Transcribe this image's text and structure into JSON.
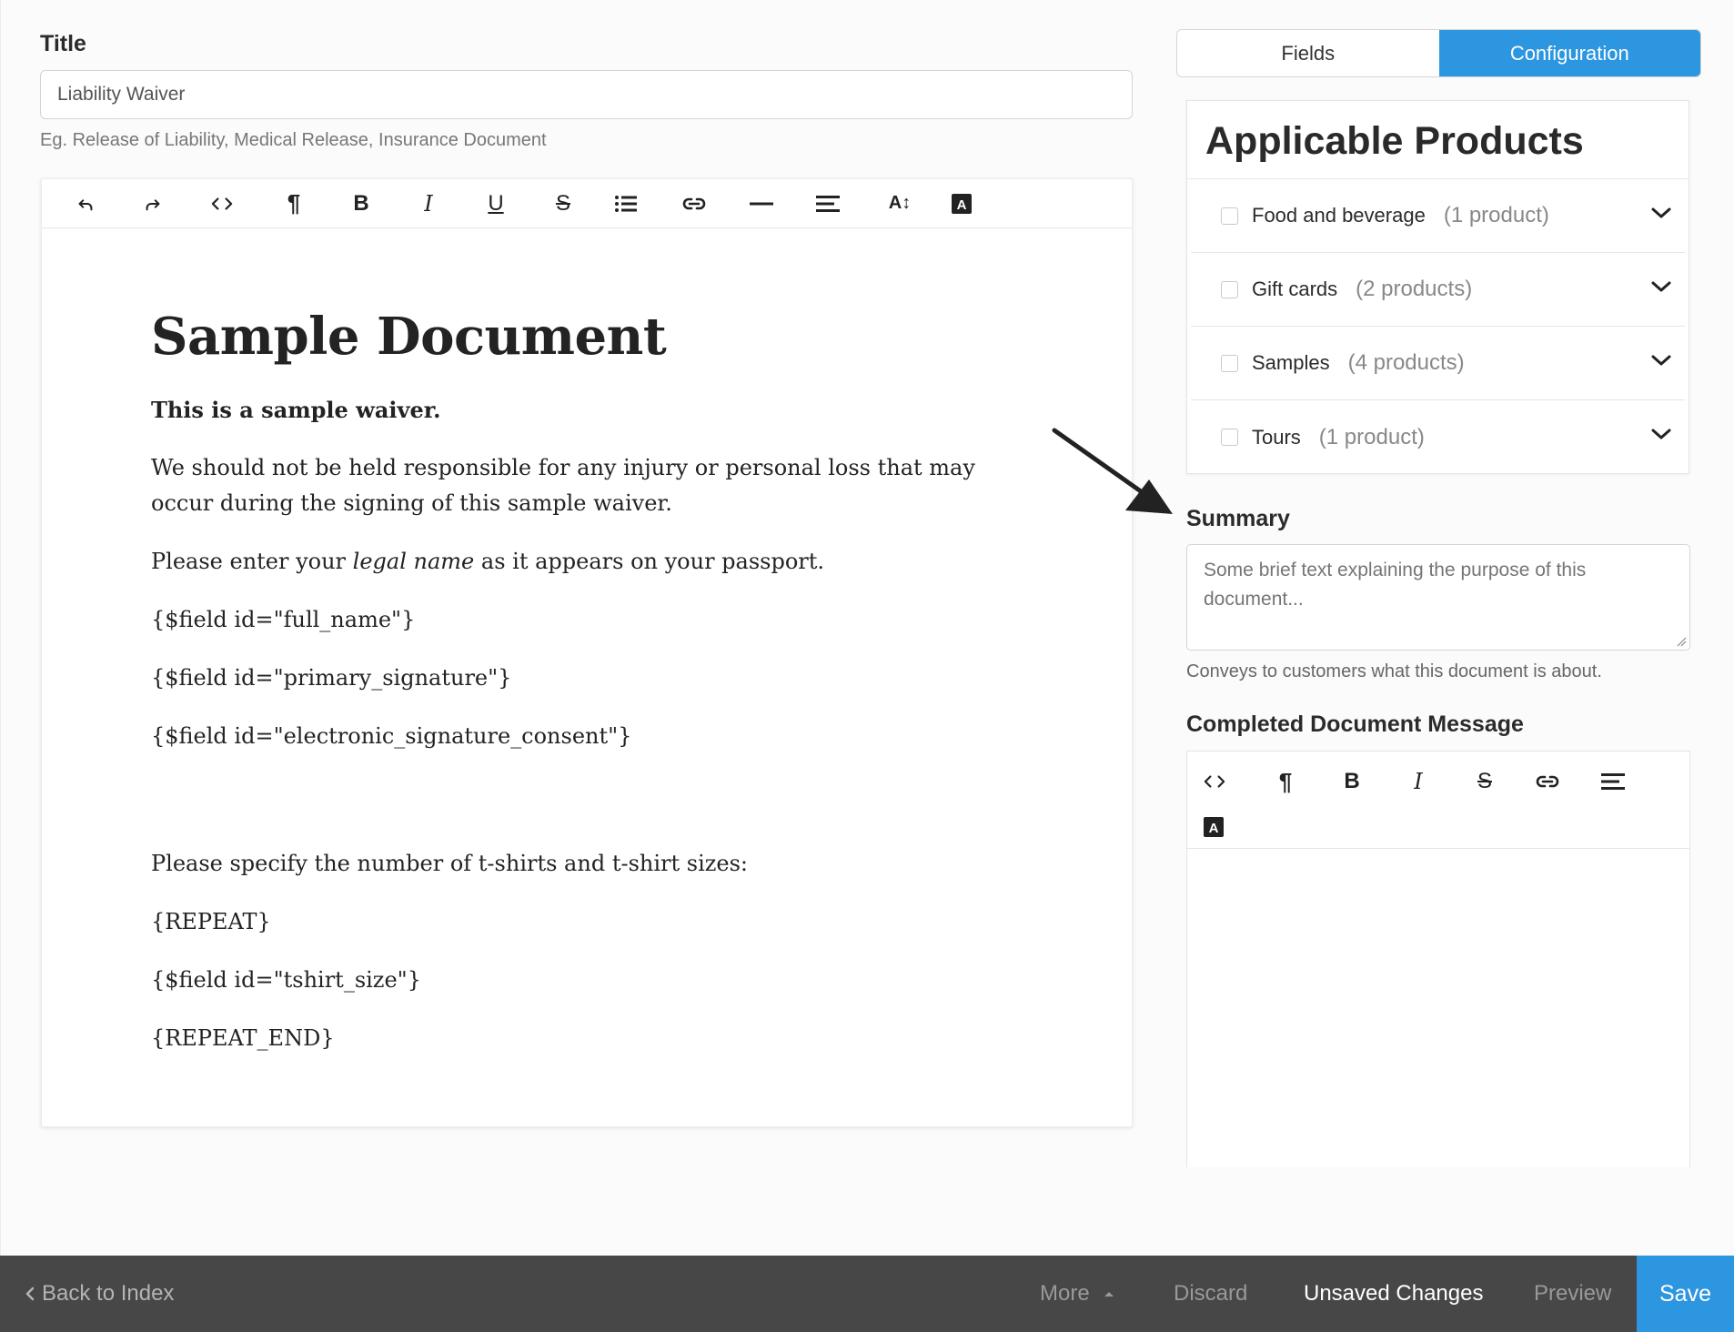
{
  "title_field": {
    "label": "Title",
    "value": "Liability Waiver",
    "help": "Eg. Release of Liability, Medical Release, Insurance Document"
  },
  "editor_toolbar": {
    "buttons": [
      "undo-icon",
      "redo-icon",
      "code-icon",
      "paragraph-icon",
      "bold-icon",
      "italic-icon",
      "underline-icon",
      "strikethrough-icon",
      "list-icon",
      "link-icon",
      "horizontal-rule-icon",
      "align-icon",
      "font-size-icon",
      "text-color-icon"
    ]
  },
  "document": {
    "heading": "Sample Document",
    "lead": "This is a sample waiver.",
    "paragraph1": "We should not be held responsible for any injury or personal loss that may occur during the signing of this sample waiver.",
    "p2_before": "Please enter your ",
    "p2_italic": "legal name",
    "p2_after": " as it appears on your passport.",
    "field_full_name": "{$field id=\"full_name\"}",
    "field_signature": "{$field id=\"primary_signature\"}",
    "field_consent": "{$field id=\"electronic_signature_consent\"}",
    "tshirt_prompt": "Please specify the number of t-shirts and t-shirt sizes:",
    "repeat": "{REPEAT}",
    "field_tshirt": "{$field id=\"tshirt_size\"}",
    "repeat_end": "{REPEAT_END}"
  },
  "tabs": {
    "fields": "Fields",
    "configuration": "Configuration"
  },
  "products": {
    "heading": "Applicable Products",
    "items": [
      {
        "name": "Food and beverage",
        "count": "(1 product)"
      },
      {
        "name": "Gift cards",
        "count": "(2 products)"
      },
      {
        "name": "Samples",
        "count": "(4 products)"
      },
      {
        "name": "Tours",
        "count": "(1 product)"
      }
    ]
  },
  "summary": {
    "label": "Summary",
    "placeholder": "Some brief text explaining the purpose of this document...",
    "help": "Conveys to customers what this document is about."
  },
  "completed_message": {
    "label": "Completed Document Message"
  },
  "bottom_bar": {
    "back": "Back to Index",
    "more": "More",
    "discard": "Discard",
    "unsaved": "Unsaved Changes",
    "preview": "Preview",
    "save": "Save"
  },
  "colors": {
    "accent": "#2d96e0",
    "bottom_bar": "#474747"
  }
}
